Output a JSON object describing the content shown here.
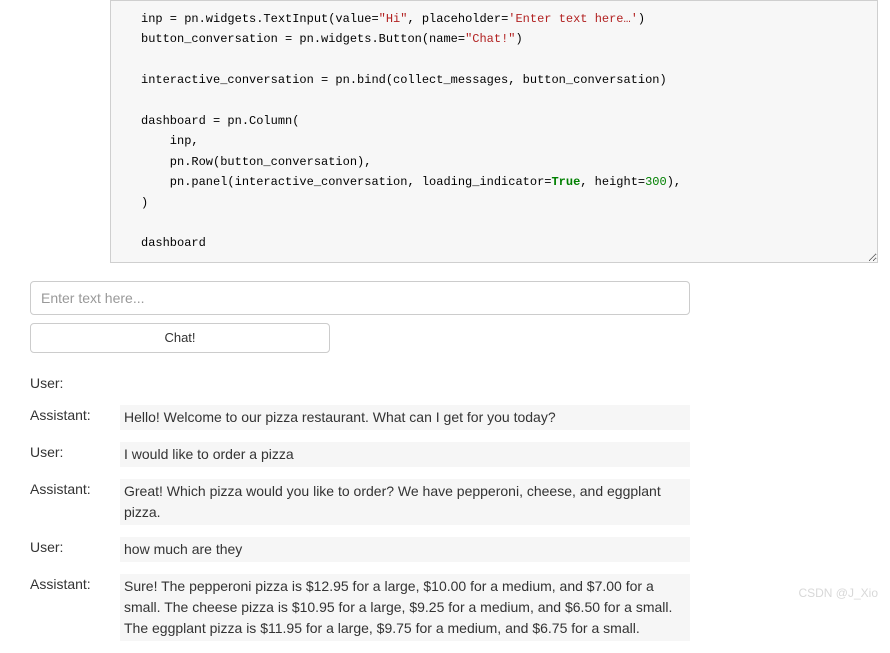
{
  "code": {
    "line1_a": "inp = pn.widgets.TextInput(value=",
    "line1_str1": "\"Hi\"",
    "line1_b": ", placeholder=",
    "line1_str2": "'Enter text here…'",
    "line1_c": ")",
    "line2_a": "button_conversation = pn.widgets.Button(name=",
    "line2_str": "\"Chat!\"",
    "line2_b": ")",
    "line4": "interactive_conversation = pn.bind(collect_messages, button_conversation)",
    "line6": "dashboard = pn.Column(",
    "line7": "    inp,",
    "line8": "    pn.Row(button_conversation),",
    "line9_a": "    pn.panel(interactive_conversation, loading_indicator=",
    "line9_true": "True",
    "line9_b": ", height=",
    "line9_num": "300",
    "line9_c": "),",
    "line10": ")",
    "line12": "dashboard"
  },
  "input": {
    "placeholder": "Enter text here...",
    "value": ""
  },
  "button_label": "Chat!",
  "conversation": [
    {
      "role": "User:",
      "msg": ""
    },
    {
      "role": "Assistant:",
      "msg": "Hello! Welcome to our pizza restaurant. What can I get for you today?"
    },
    {
      "role": "User:",
      "msg": "I would like to order a pizza"
    },
    {
      "role": "Assistant:",
      "msg": "Great! Which pizza would you like to order? We have pepperoni, cheese, and eggplant pizza."
    },
    {
      "role": "User:",
      "msg": "how much are they"
    },
    {
      "role": "Assistant:",
      "msg": "Sure! The pepperoni pizza is $12.95 for a large, $10.00 for a medium, and $7.00 for a small. The cheese pizza is $10.95 for a large, $9.25 for a medium, and $6.50 for a small. The eggplant pizza is $11.95 for a large, $9.75 for a medium, and $6.75 for a small."
    }
  ],
  "watermark": "CSDN @J_Xio"
}
